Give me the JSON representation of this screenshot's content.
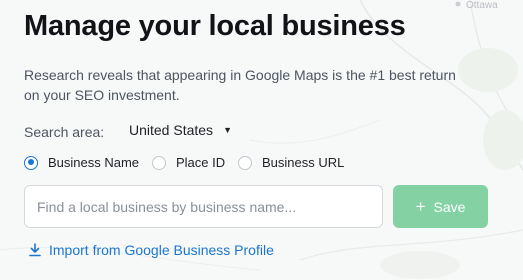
{
  "header": {
    "title": "Manage your local business",
    "description": "Research reveals that appearing in Google Maps is the #1 best return on your SEO investment."
  },
  "search_area": {
    "label": "Search area:",
    "selected": "United States"
  },
  "search_type": {
    "options": [
      {
        "label": "Business Name",
        "checked": true
      },
      {
        "label": "Place ID",
        "checked": false
      },
      {
        "label": "Business URL",
        "checked": false
      }
    ]
  },
  "search": {
    "placeholder": "Find a local business by business name...",
    "value": ""
  },
  "actions": {
    "save_label": "Save",
    "import_label": "Import from Google Business Profile"
  },
  "map": {
    "place_label": "Ottawa"
  },
  "colors": {
    "accent_blue": "#1b76d1",
    "save_green": "#84d2a4",
    "background": "#f7f8f8"
  }
}
